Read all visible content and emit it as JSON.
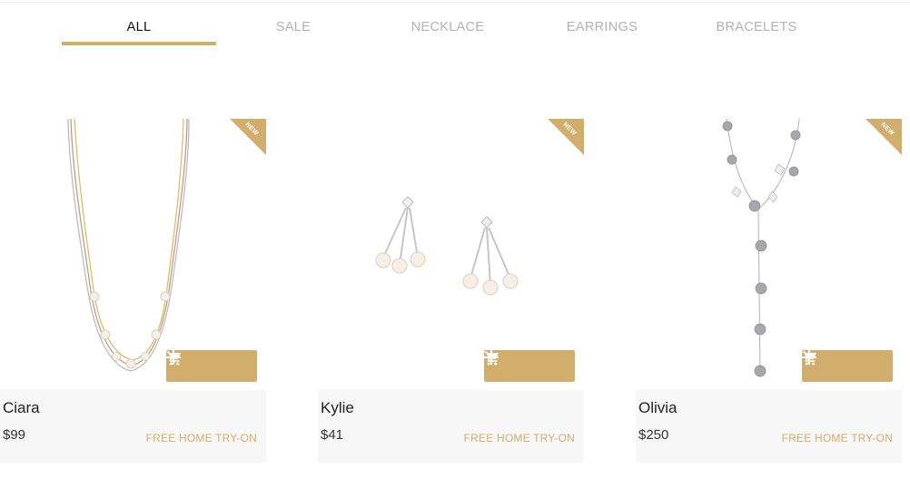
{
  "tabs": [
    {
      "label": "ALL",
      "active": true
    },
    {
      "label": "SALE",
      "active": false
    },
    {
      "label": "NECKLACE",
      "active": false
    },
    {
      "label": "EARRINGS",
      "active": false
    },
    {
      "label": "BRACELETS",
      "active": false
    }
  ],
  "colors": {
    "accent": "#d2ae6d",
    "info_bg": "#f7f7f7",
    "inactive_tab": "#b2b2b2"
  },
  "icons": {
    "add": "plus-icon",
    "cart": "shopping-cart-icon"
  },
  "products": [
    {
      "name": "Ciara",
      "price": "$99",
      "badge": "NEW",
      "try_on": "FREE HOME TRY-ON"
    },
    {
      "name": "Kylie",
      "price": "$41",
      "badge": "NEW",
      "try_on": "FREE HOME TRY-ON"
    },
    {
      "name": "Olivia",
      "price": "$250",
      "badge": "NEW",
      "try_on": "FREE HOME TRY-ON"
    }
  ]
}
